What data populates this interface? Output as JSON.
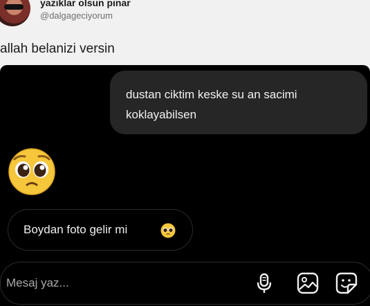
{
  "tweet": {
    "name": "yazıklar olsun pınar",
    "handle": "@dalgageciyorum",
    "text": "allah belanizi versin"
  },
  "chat": {
    "sent_message": "dustan ciktim keske su an sacimi koklayabilsen",
    "emoji_message": "pleading-face-emoji",
    "received_message": "Boydan foto gelir mi",
    "composer_placeholder": "Mesaj yaz...",
    "icons": [
      "microphone-icon",
      "gallery-icon",
      "sticker-icon"
    ]
  },
  "colors": {
    "chat_background": "#000000",
    "sent_bubble": "#262626",
    "page_background": "#f1f1f1"
  }
}
